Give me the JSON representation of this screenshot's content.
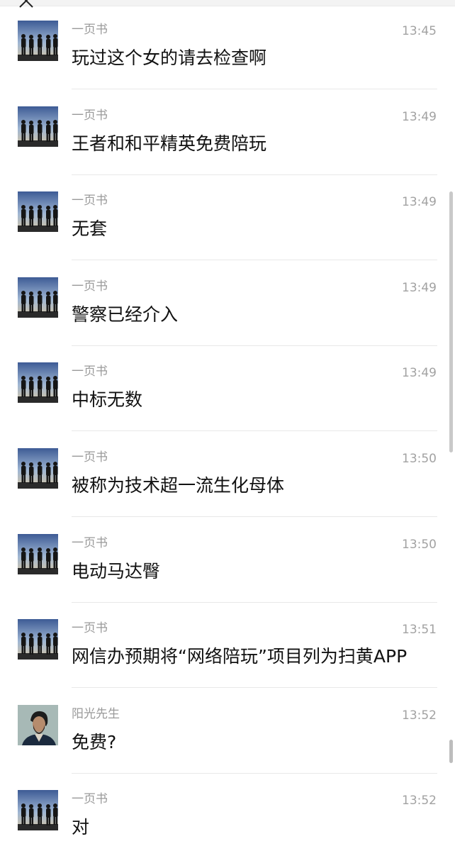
{
  "messages": [
    {
      "sender": "一页书",
      "time": "13:45",
      "text": "玩过这个女的请去检查啊",
      "avatar": "group-silhouette"
    },
    {
      "sender": "一页书",
      "time": "13:49",
      "text": "王者和和平精英免费陪玩",
      "avatar": "group-silhouette"
    },
    {
      "sender": "一页书",
      "time": "13:49",
      "text": "无套",
      "avatar": "group-silhouette"
    },
    {
      "sender": "一页书",
      "time": "13:49",
      "text": "警察已经介入",
      "avatar": "group-silhouette"
    },
    {
      "sender": "一页书",
      "time": "13:49",
      "text": "中标无数",
      "avatar": "group-silhouette"
    },
    {
      "sender": "一页书",
      "time": "13:50",
      "text": "被称为技术超一流生化母体",
      "avatar": "group-silhouette"
    },
    {
      "sender": "一页书",
      "time": "13:50",
      "text": "电动马达臀",
      "avatar": "group-silhouette"
    },
    {
      "sender": "一页书",
      "time": "13:51",
      "text": "网信办预期将“网络陪玩”项目列为扫黄APP",
      "avatar": "group-silhouette"
    },
    {
      "sender": "阳光先生",
      "time": "13:52",
      "text": "免费?",
      "avatar": "man-portrait"
    },
    {
      "sender": "一页书",
      "time": "13:52",
      "text": "对",
      "avatar": "group-silhouette"
    }
  ],
  "icons": {
    "close": "close-icon"
  },
  "colors": {
    "background": "#ffffff",
    "sender": "#9a9a9a",
    "time": "#a2a2a2",
    "message_text": "#111111",
    "divider": "#e8e8e8"
  }
}
